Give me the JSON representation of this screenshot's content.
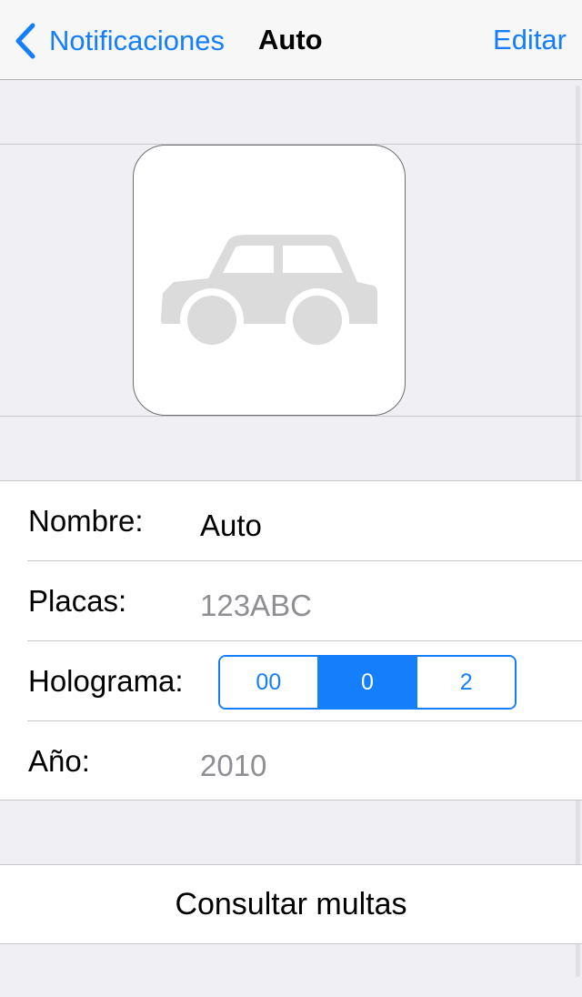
{
  "nav": {
    "back_label": "Notificaciones",
    "title": "Auto",
    "edit_label": "Editar"
  },
  "photo": {
    "icon": "car-icon",
    "icon_color": "#dcdbdc"
  },
  "form": {
    "nombre": {
      "label": "Nombre:",
      "value": "Auto"
    },
    "placas": {
      "label": "Placas:",
      "value": "123ABC"
    },
    "holograma": {
      "label": "Holograma:",
      "options": [
        "00",
        "0",
        "2"
      ],
      "selected": "0"
    },
    "anio": {
      "label": "Año:",
      "value": "2010"
    }
  },
  "actions": {
    "consultar_label": "Consultar multas"
  },
  "colors": {
    "accent": "#147efb",
    "background": "#efeff4",
    "separator": "#c8c7cc",
    "secondary_text": "#8e8e93"
  }
}
